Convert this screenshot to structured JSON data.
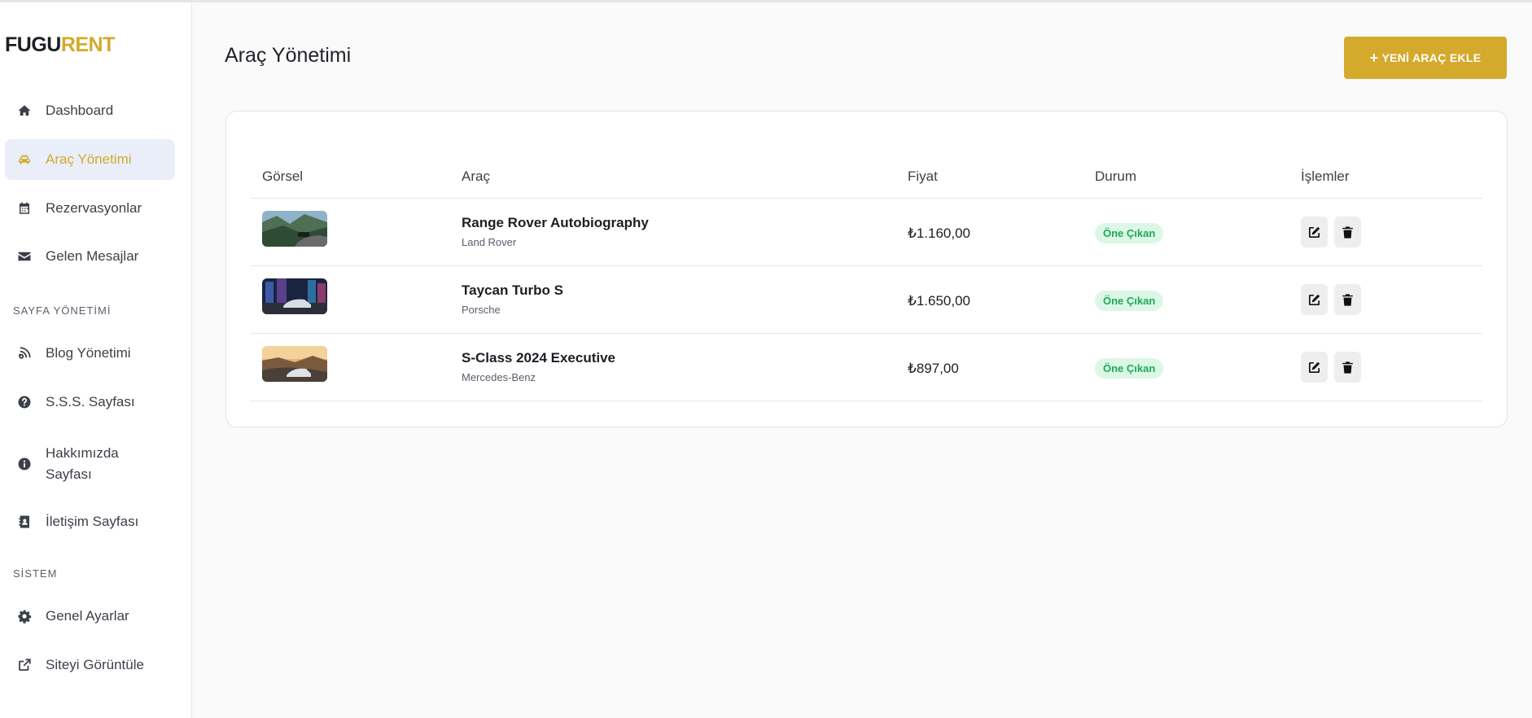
{
  "brand": {
    "part1": "FUGU",
    "part2": "RENT"
  },
  "sidebar": {
    "items": [
      {
        "label": "Dashboard",
        "icon": "home-icon"
      },
      {
        "label": "Araç Yönetimi",
        "icon": "car-icon"
      },
      {
        "label": "Rezervasyonlar",
        "icon": "calendar-icon"
      },
      {
        "label": "Gelen Mesajlar",
        "icon": "envelope-icon"
      }
    ],
    "section_page": "SAYFA YÖNETİMİ",
    "page_items": [
      {
        "label": "Blog Yönetimi",
        "icon": "blog-icon"
      },
      {
        "label": "S.S.S. Sayfası",
        "icon": "question-icon"
      },
      {
        "label": "Hakkımızda Sayfası",
        "icon": "info-icon"
      },
      {
        "label": "İletişim Sayfası",
        "icon": "contact-book-icon"
      }
    ],
    "section_system": "SİSTEM",
    "system_items": [
      {
        "label": "Genel Ayarlar",
        "icon": "gear-icon"
      },
      {
        "label": "Siteyi Görüntüle",
        "icon": "external-link-icon"
      }
    ]
  },
  "main": {
    "title": "Araç Yönetimi",
    "add_button": {
      "plus": "+",
      "label": "YENİ ARAÇ EKLE"
    }
  },
  "table": {
    "headers": [
      "Görsel",
      "Araç",
      "Fiyat",
      "Durum",
      "İşlemler"
    ],
    "rows": [
      {
        "name": "Range Rover Autobiography",
        "brand": "Land Rover",
        "price": "₺1.160,00",
        "status": "Öne Çıkan"
      },
      {
        "name": "Taycan Turbo S",
        "brand": "Porsche",
        "price": "₺1.650,00",
        "status": "Öne Çıkan"
      },
      {
        "name": "S-Class 2024 Executive",
        "brand": "Mercedes-Benz",
        "price": "₺897,00",
        "status": "Öne Çıkan"
      }
    ]
  },
  "colors": {
    "accent": "#d4aa2c",
    "active_bg": "#e9eef8",
    "badge_bg": "#dcf7e6",
    "badge_text": "#1fa957"
  }
}
